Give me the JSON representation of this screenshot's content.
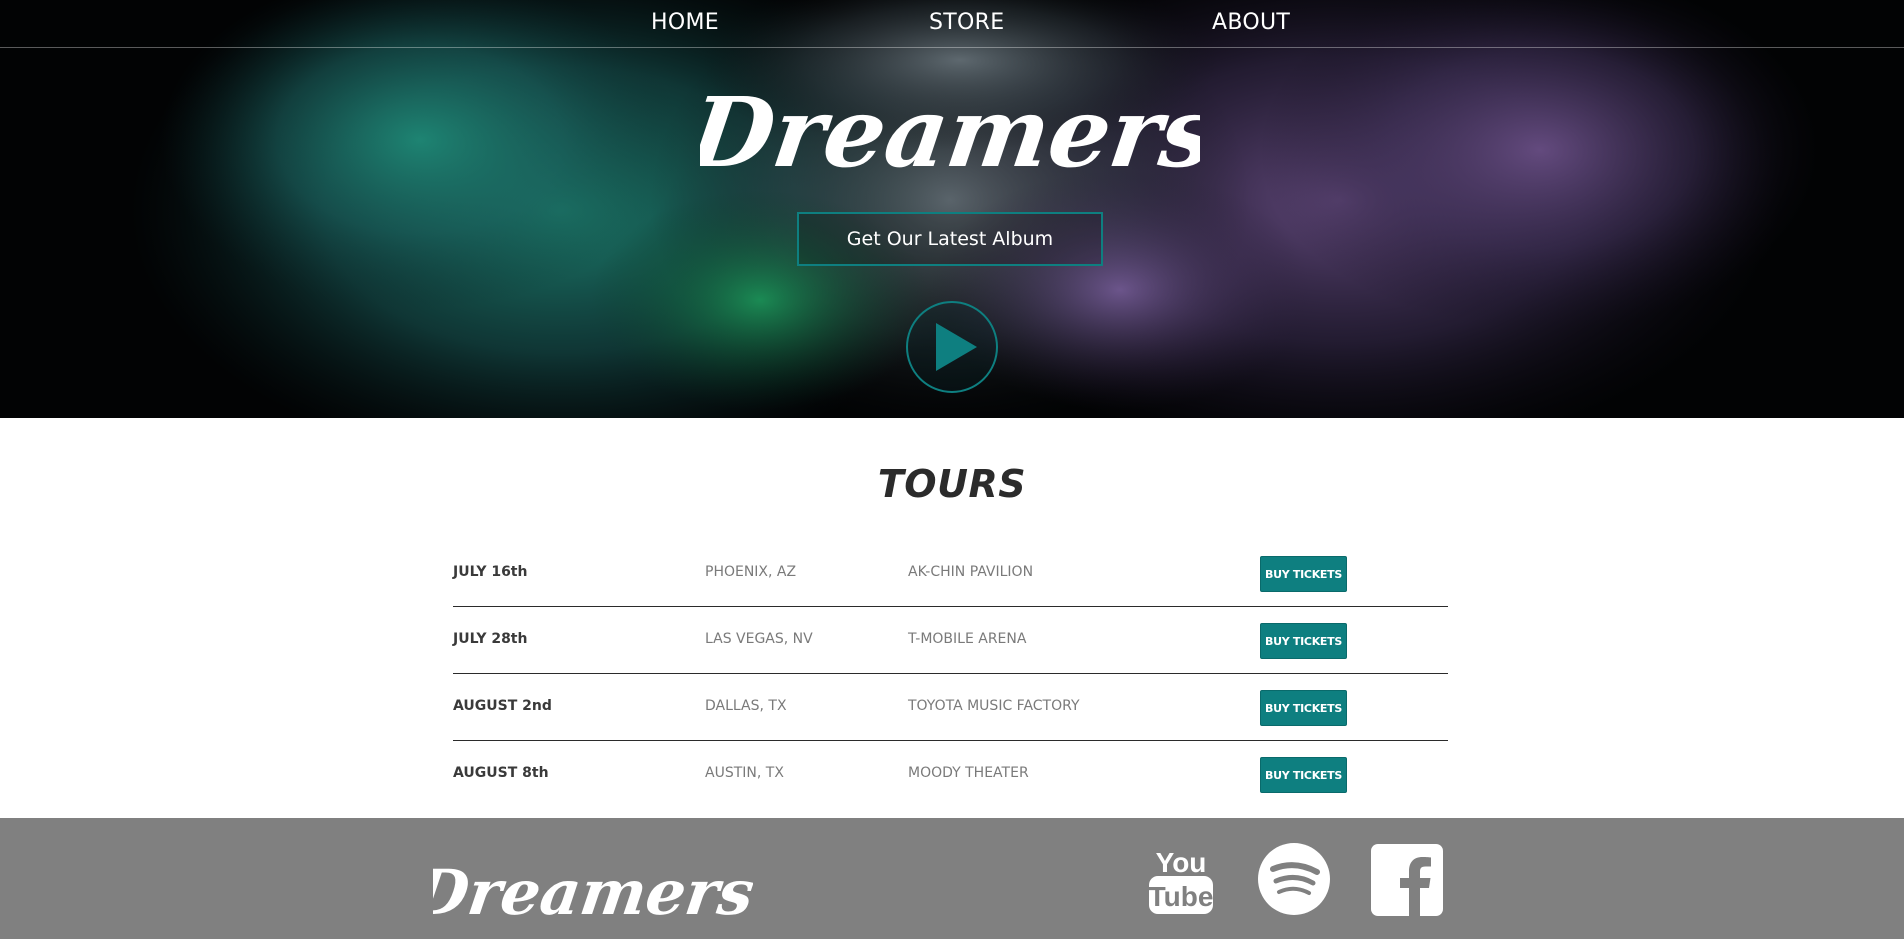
{
  "nav": {
    "home": "HOME",
    "store": "STORE",
    "about": "ABOUT"
  },
  "hero": {
    "brand": "Dreamers",
    "album_button": "Get Our Latest Album"
  },
  "tours": {
    "title": "TOURS",
    "rows": [
      {
        "date": "JULY 16th",
        "city": "PHOENIX, AZ",
        "venue": "AK-CHIN PAVILION",
        "button": "BUY TICKETS"
      },
      {
        "date": "JULY 28th",
        "city": "LAS VEGAS, NV",
        "venue": "T-MOBILE ARENA",
        "button": "BUY TICKETS"
      },
      {
        "date": "AUGUST 2nd",
        "city": "DALLAS, TX",
        "venue": "TOYOTA MUSIC FACTORY",
        "button": "BUY TICKETS"
      },
      {
        "date": "AUGUST 8th",
        "city": "AUSTIN, TX",
        "venue": "MOODY THEATER",
        "button": "BUY TICKETS"
      }
    ]
  },
  "footer": {
    "brand": "Dreamers",
    "youtube_you": "You",
    "youtube_tube": "Tube",
    "social_icons": [
      "youtube-icon",
      "spotify-icon",
      "facebook-icon"
    ]
  },
  "colors": {
    "accent": "#0e7f80",
    "footer_bg": "#808080",
    "text_dark": "#2b2b2b",
    "text_muted": "#7a7a7a"
  }
}
